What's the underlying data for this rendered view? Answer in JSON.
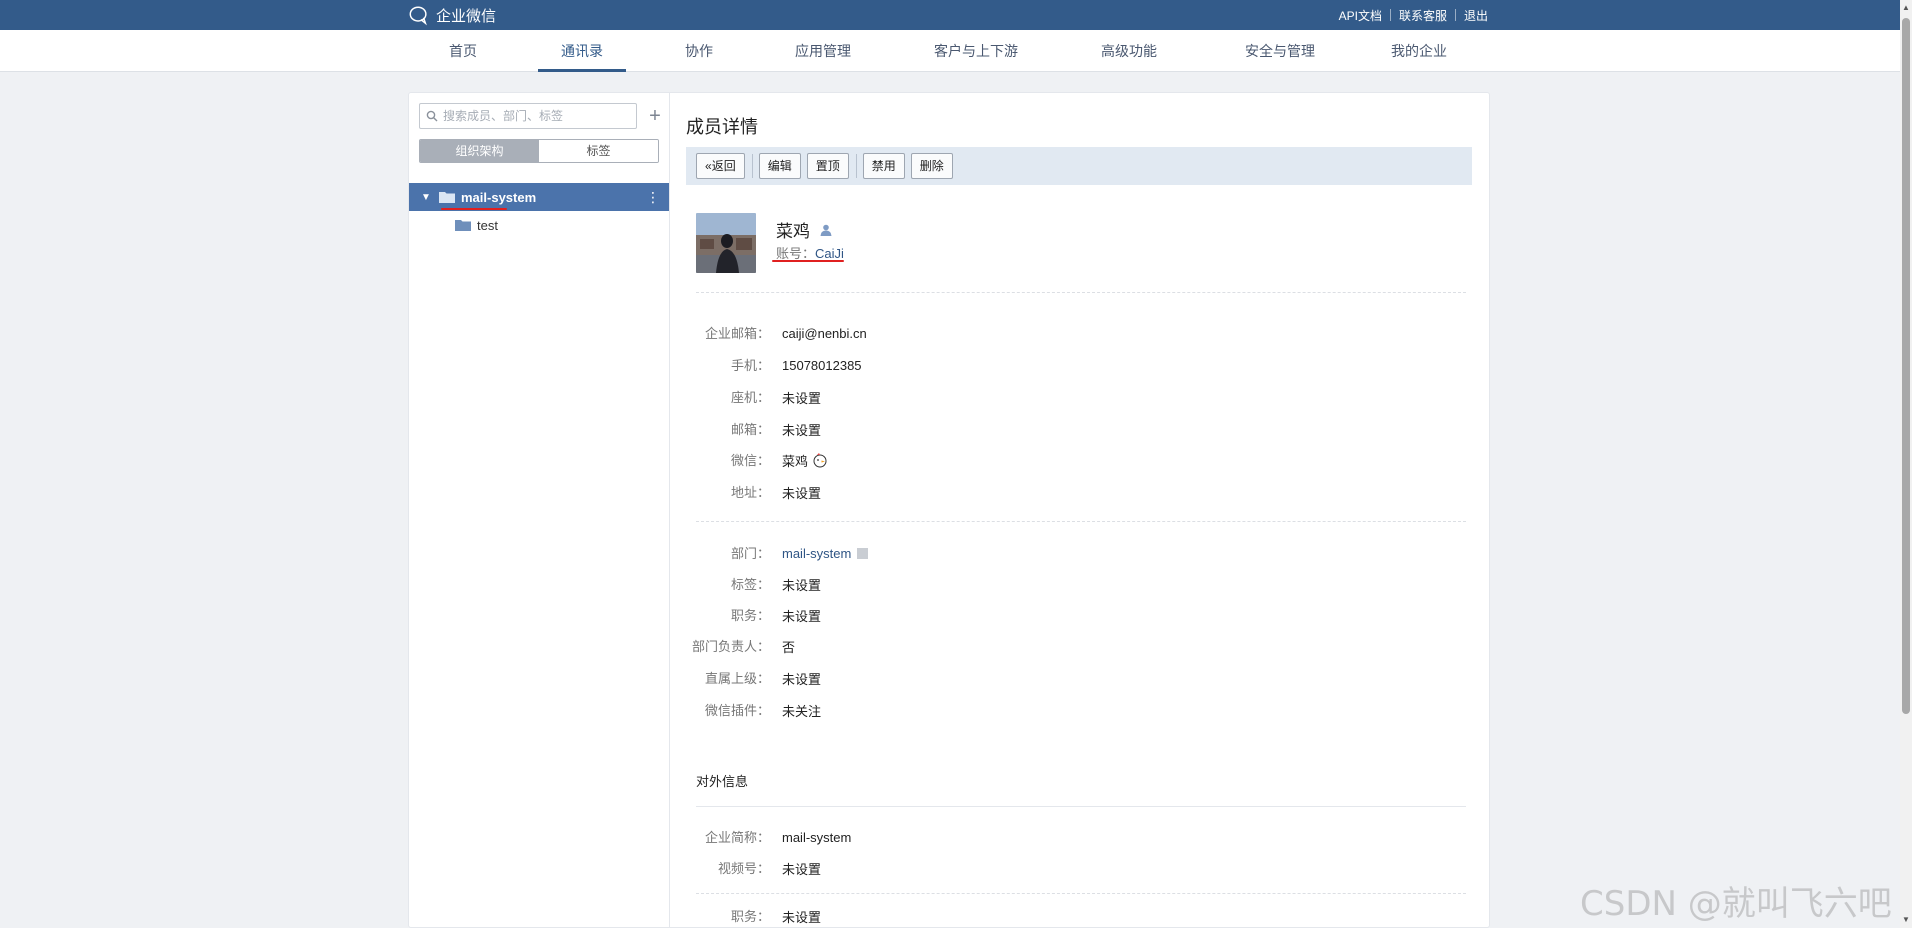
{
  "app": {
    "title": "企业微信"
  },
  "toplinks": [
    "API文档",
    "联系客服",
    "退出"
  ],
  "nav": {
    "items": [
      {
        "label": "首页",
        "active": false
      },
      {
        "label": "通讯录",
        "active": true
      },
      {
        "label": "协作",
        "active": false
      },
      {
        "label": "应用管理",
        "active": false
      },
      {
        "label": "客户与上下游",
        "active": false
      },
      {
        "label": "高级功能",
        "active": false
      },
      {
        "label": "安全与管理",
        "active": false
      },
      {
        "label": "我的企业",
        "active": false
      }
    ]
  },
  "sidebar": {
    "search_placeholder": "搜索成员、部门、标签",
    "tabs": [
      {
        "label": "组织架构",
        "active": true
      },
      {
        "label": "标签",
        "active": false
      }
    ],
    "tree": [
      {
        "label": "mail-system",
        "selected": true,
        "expanded": true
      },
      {
        "label": "test",
        "selected": false
      }
    ]
  },
  "detail": {
    "title": "成员详情",
    "buttons": {
      "back": "返回",
      "edit": "编辑",
      "pin": "置顶",
      "disable": "禁用",
      "delete": "删除"
    },
    "name": "菜鸡",
    "account_label": "账号：",
    "account_value": "CaiJi",
    "contact_fields": [
      {
        "label": "企业邮箱：",
        "value": "caiji@nenbi.cn"
      },
      {
        "label": "手机：",
        "value": "15078012385"
      },
      {
        "label": "座机：",
        "value": "未设置"
      },
      {
        "label": "邮箱：",
        "value": "未设置"
      },
      {
        "label": "微信：",
        "value": "菜鸡"
      },
      {
        "label": "地址：",
        "value": "未设置"
      }
    ],
    "org_fields": [
      {
        "label": "部门：",
        "value": "mail-system"
      },
      {
        "label": "标签：",
        "value": "未设置"
      },
      {
        "label": "职务：",
        "value": "未设置"
      },
      {
        "label": "部门负责人：",
        "value": "否"
      },
      {
        "label": "直属上级：",
        "value": "未设置"
      },
      {
        "label": "微信插件：",
        "value": "未关注"
      }
    ],
    "external_title": "对外信息",
    "external_fields": [
      {
        "label": "企业简称：",
        "value": "mail-system"
      },
      {
        "label": "视频号：",
        "value": "未设置"
      }
    ],
    "extra_fields": [
      {
        "label": "职务：",
        "value": "未设置"
      }
    ]
  },
  "watermark": "CSDN @就叫飞六吧",
  "colors": {
    "brand": "#335b8a",
    "selected": "#4b73ab",
    "link": "#2f5585",
    "annotation": "#e02020"
  }
}
